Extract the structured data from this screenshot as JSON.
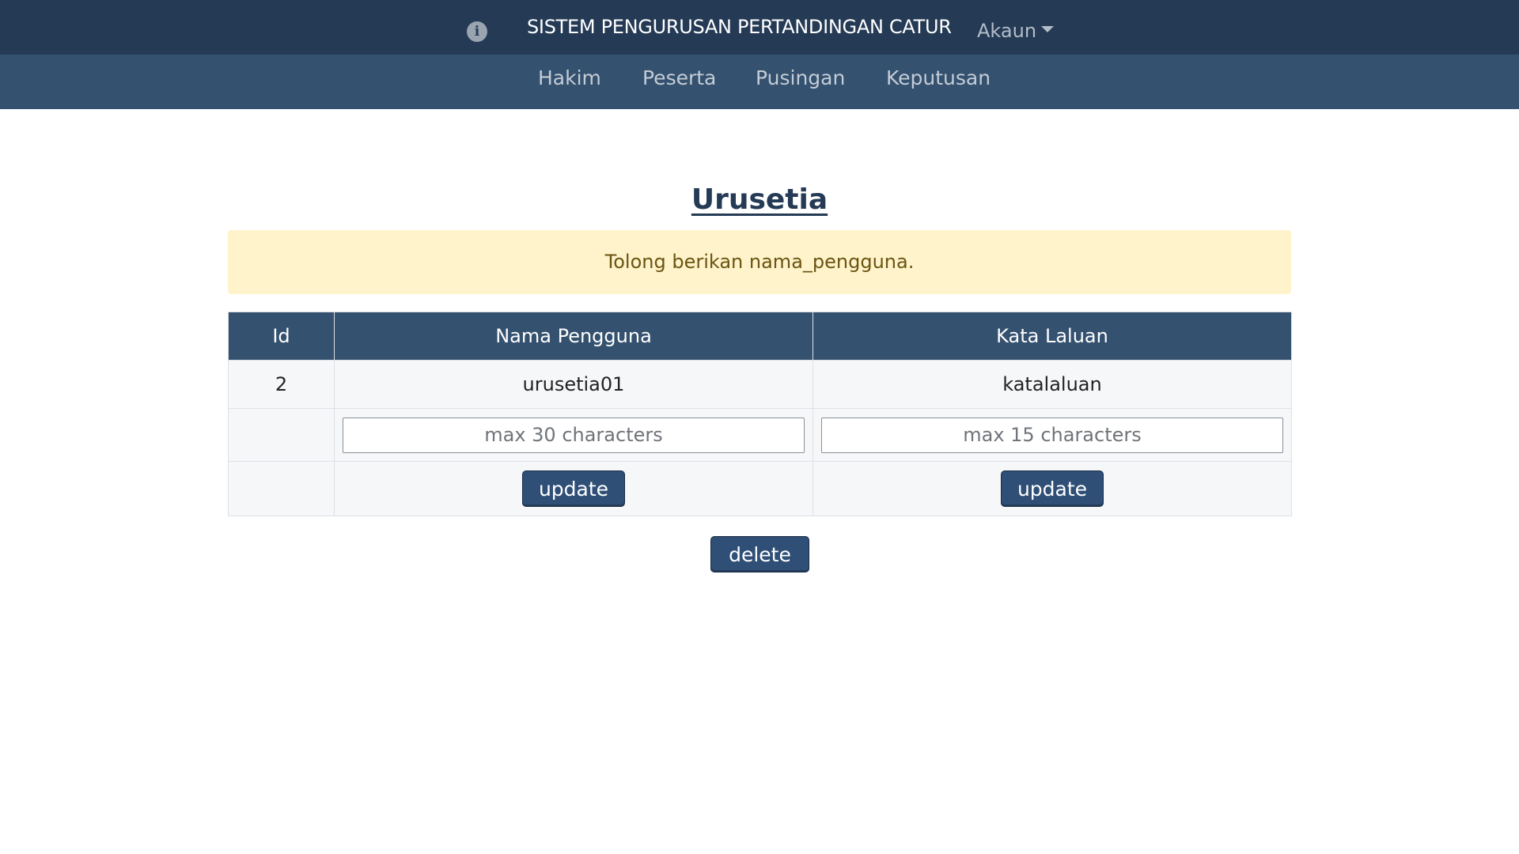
{
  "header": {
    "info_icon": "info-icon",
    "title": "SISTEM PENGURUSAN PERTANDINGAN CATUR",
    "account_label": "Akaun"
  },
  "nav": {
    "items": [
      {
        "label": "Hakim"
      },
      {
        "label": "Peserta"
      },
      {
        "label": "Pusingan"
      },
      {
        "label": "Keputusan"
      }
    ]
  },
  "main": {
    "title": "Urusetia",
    "alert": "Tolong berikan nama_pengguna.",
    "table": {
      "headers": [
        "Id",
        "Nama Pengguna",
        "Kata Laluan"
      ],
      "row": {
        "id": "2",
        "username": "urusetia01",
        "password": "katalaluan"
      },
      "username_placeholder": "max 30 characters",
      "password_placeholder": "max 15 characters",
      "update_label": "update"
    },
    "delete_label": "delete"
  },
  "colors": {
    "topbar": "#243a55",
    "subnav": "#34516f",
    "alert_bg": "#fff3cc",
    "button": "#2f4f77"
  }
}
